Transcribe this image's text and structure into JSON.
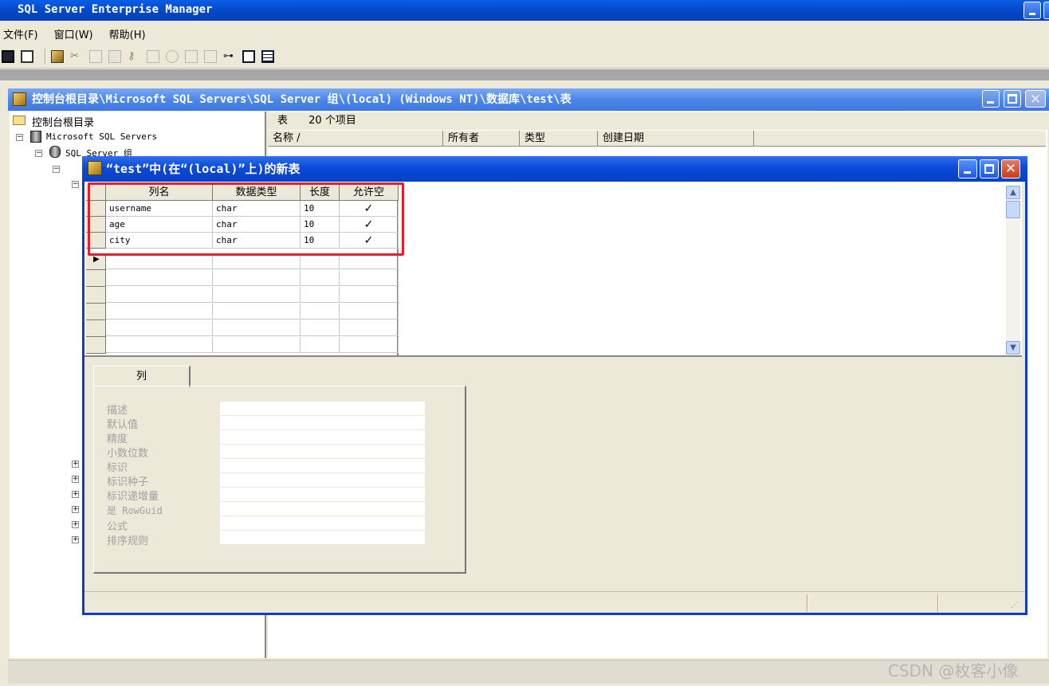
{
  "app": {
    "title": "SQL Server Enterprise Manager"
  },
  "menu": {
    "items": [
      "文件(F)",
      "窗口(W)",
      "帮助(H)"
    ]
  },
  "toolbar": {
    "icons": [
      "save-icon",
      "properties-icon",
      "new-table-icon",
      "cut-icon",
      "copy-icon",
      "paste-icon",
      "key-icon",
      "relationships-icon",
      "indexes-icon",
      "constraints-icon",
      "triggers-icon",
      "diagram-icon",
      "script-icon",
      "grid-icon"
    ]
  },
  "child_window": {
    "title": "控制台根目录\\Microsoft SQL Servers\\SQL Server 组\\(local) (Windows NT)\\数据库\\test\\表"
  },
  "tree": {
    "root": "控制台根目录",
    "servers": "Microsoft SQL Servers",
    "group": "SQL Server 组"
  },
  "list": {
    "header_label": "表",
    "header_count": "20 个项目",
    "columns": [
      "名称 /",
      "所有者",
      "类型",
      "创建日期"
    ]
  },
  "dialog": {
    "title": "“test”中(在“(local)”上)的新表",
    "grid_headers": [
      "列名",
      "数据类型",
      "长度",
      "允许空"
    ],
    "rows": [
      {
        "name": "username",
        "type": "char",
        "length": "10",
        "nullable": "✓"
      },
      {
        "name": "age",
        "type": "char",
        "length": "10",
        "nullable": "✓"
      },
      {
        "name": "city",
        "type": "char",
        "length": "10",
        "nullable": "✓"
      }
    ],
    "tab_label": "列",
    "properties": [
      "描述",
      "默认值",
      "精度",
      "小数位数",
      "标识",
      "标识种子",
      "标识递增量",
      "是 RowGuid",
      "公式",
      "排序规则"
    ]
  },
  "watermark": "CSDN @枚客小像",
  "colors": {
    "titlebar": "#0a4ad6",
    "highlight": "#e0202c",
    "face": "#ece9d8"
  }
}
